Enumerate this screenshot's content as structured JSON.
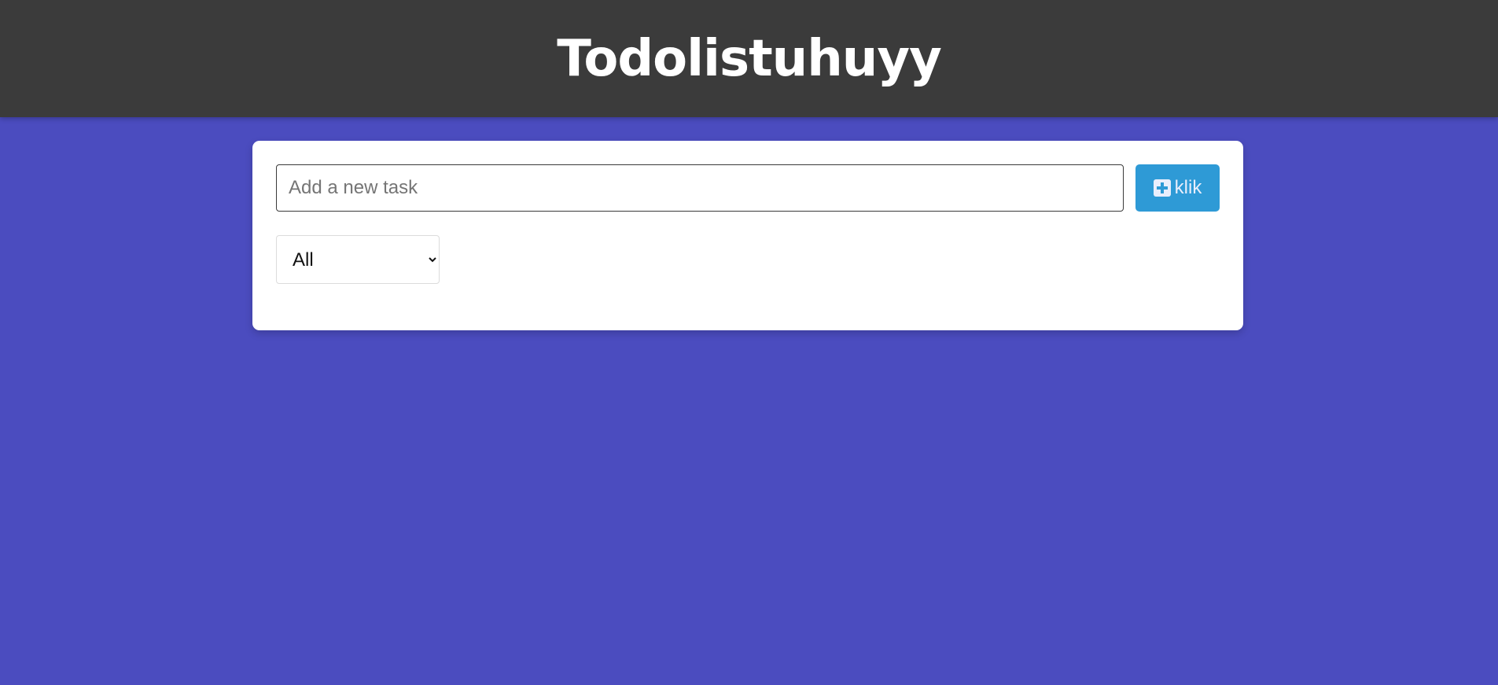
{
  "header": {
    "title": "Todolistuhuyy"
  },
  "form": {
    "task_placeholder": "Add a new task",
    "task_value": "",
    "add_button_label": "klik",
    "add_button_icon": "plus-square-icon"
  },
  "filter": {
    "selected": "All"
  },
  "colors": {
    "background": "#4b4cbf",
    "header": "#3b3b3b",
    "button": "#2e9ad6"
  }
}
